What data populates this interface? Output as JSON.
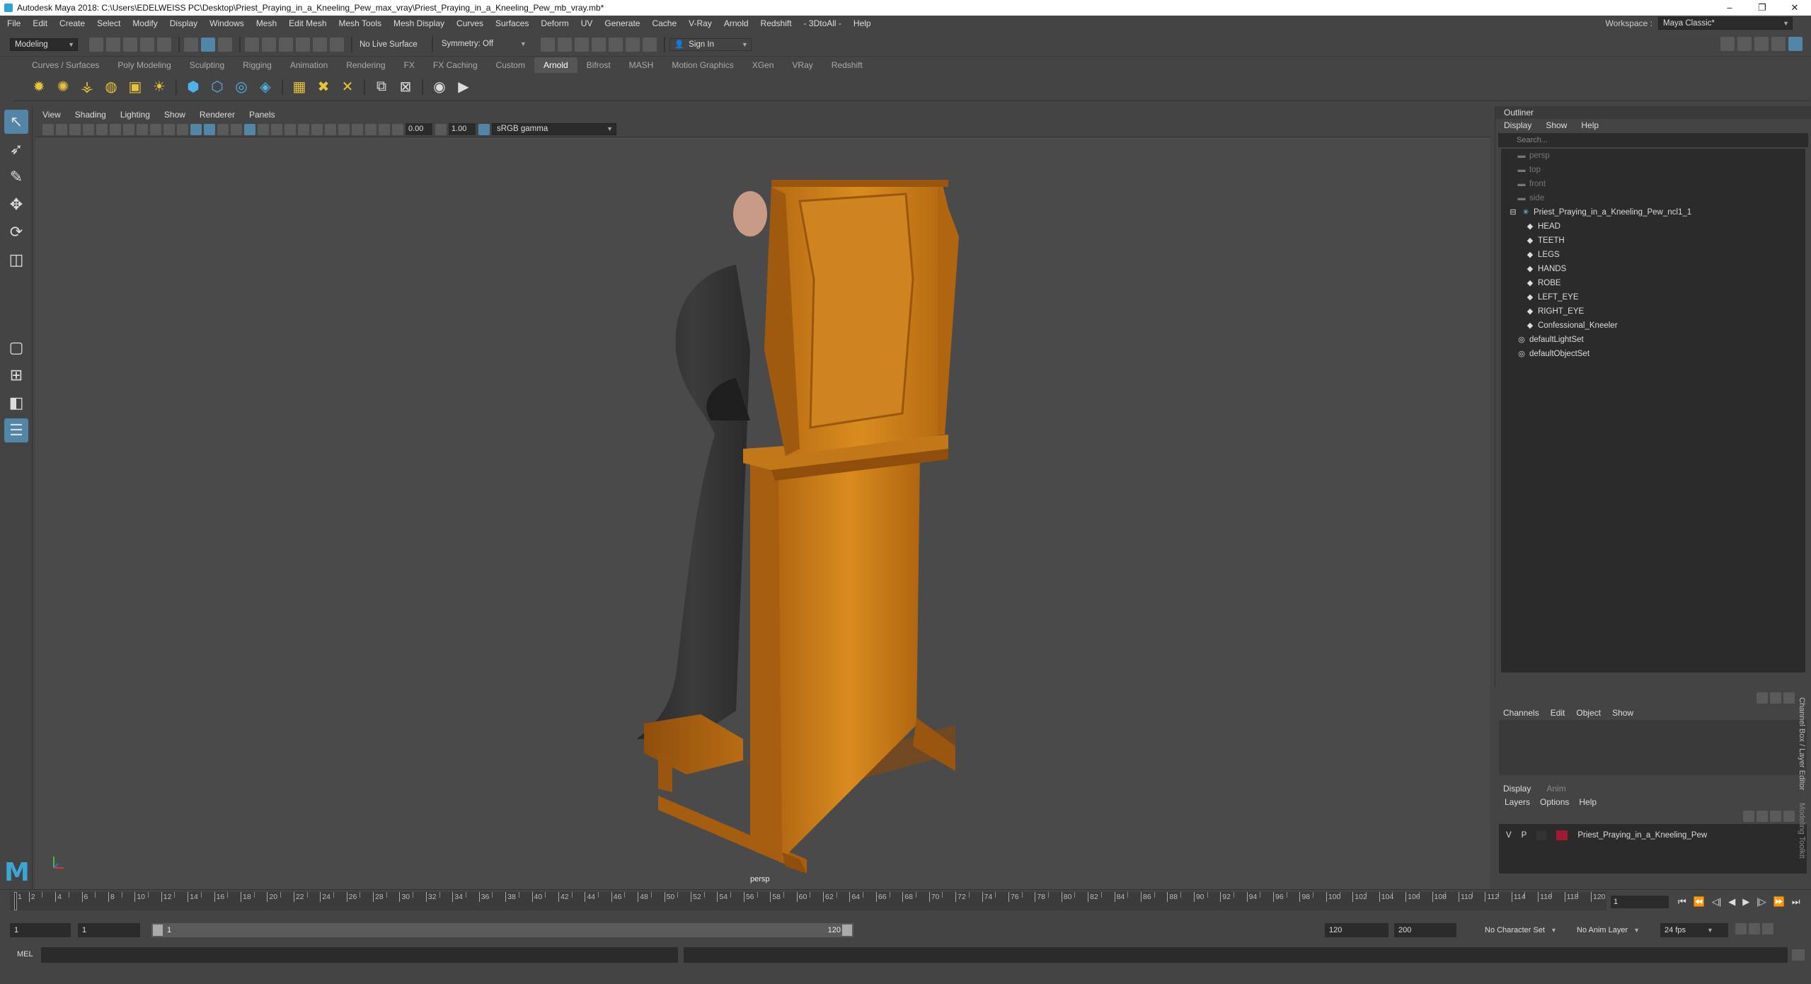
{
  "app": {
    "title": "Autodesk Maya 2018: C:\\Users\\EDELWEISS PC\\Desktop\\Priest_Praying_in_a_Kneeling_Pew_max_vray\\Priest_Praying_in_a_Kneeling_Pew_mb_vray.mb*"
  },
  "window_buttons": [
    "–",
    "❐",
    "✕"
  ],
  "menubar": [
    "File",
    "Edit",
    "Create",
    "Select",
    "Modify",
    "Display",
    "Windows",
    "Mesh",
    "Edit Mesh",
    "Mesh Tools",
    "Mesh Display",
    "Curves",
    "Surfaces",
    "Deform",
    "UV",
    "Generate",
    "Cache",
    "V-Ray",
    "Arnold",
    "Redshift",
    "- 3DtoAll -",
    "Help"
  ],
  "workspace": {
    "label": "Workspace :",
    "value": "Maya Classic*"
  },
  "status": {
    "mode": "Modeling",
    "live_surface": "No Live Surface",
    "symmetry": "Symmetry: Off",
    "sign_in": "Sign In"
  },
  "shelf_tabs": [
    "Curves / Surfaces",
    "Poly Modeling",
    "Sculpting",
    "Rigging",
    "Animation",
    "Rendering",
    "FX",
    "FX Caching",
    "Custom",
    "Arnold",
    "Bifrost",
    "MASH",
    "Motion Graphics",
    "XGen",
    "VRay",
    "Redshift"
  ],
  "shelf_active": "Arnold",
  "viewport": {
    "menu": [
      "View",
      "Shading",
      "Lighting",
      "Show",
      "Renderer",
      "Panels"
    ],
    "exposure": "0.00",
    "gamma": "1.00",
    "colorspace": "sRGB gamma",
    "camera": "persp"
  },
  "outliner": {
    "title": "Outliner",
    "menu": [
      "Display",
      "Show",
      "Help"
    ],
    "search_placeholder": "Search...",
    "items": [
      {
        "label": "persp",
        "icon": "camera-icon",
        "dim": true,
        "indent": 1
      },
      {
        "label": "top",
        "icon": "camera-icon",
        "dim": true,
        "indent": 1
      },
      {
        "label": "front",
        "icon": "camera-icon",
        "dim": true,
        "indent": 1
      },
      {
        "label": "side",
        "icon": "camera-icon",
        "dim": true,
        "indent": 1
      },
      {
        "label": "Priest_Praying_in_a_Kneeling_Pew_ncl1_1",
        "icon": "group-icon",
        "dim": false,
        "indent": 0
      },
      {
        "label": "HEAD",
        "icon": "mesh-icon",
        "dim": false,
        "indent": 2
      },
      {
        "label": "TEETH",
        "icon": "mesh-icon",
        "dim": false,
        "indent": 2
      },
      {
        "label": "LEGS",
        "icon": "mesh-icon",
        "dim": false,
        "indent": 2
      },
      {
        "label": "HANDS",
        "icon": "mesh-icon",
        "dim": false,
        "indent": 2
      },
      {
        "label": "ROBE",
        "icon": "mesh-icon",
        "dim": false,
        "indent": 2
      },
      {
        "label": "LEFT_EYE",
        "icon": "mesh-icon",
        "dim": false,
        "indent": 2
      },
      {
        "label": "RIGHT_EYE",
        "icon": "mesh-icon",
        "dim": false,
        "indent": 2
      },
      {
        "label": "Confessional_Kneeler",
        "icon": "mesh-icon",
        "dim": false,
        "indent": 2
      },
      {
        "label": "defaultLightSet",
        "icon": "set-icon",
        "dim": false,
        "indent": 1
      },
      {
        "label": "defaultObjectSet",
        "icon": "set-icon",
        "dim": false,
        "indent": 1
      }
    ]
  },
  "channels": {
    "menu": [
      "Channels",
      "Edit",
      "Object",
      "Show"
    ]
  },
  "layers": {
    "tabs": [
      "Display",
      "Anim"
    ],
    "menu": [
      "Layers",
      "Options",
      "Help"
    ],
    "rows": [
      {
        "v": "V",
        "p": "P",
        "name": "Priest_Praying_in_a_Kneeling_Pew",
        "color": "#a11a31"
      }
    ]
  },
  "side_tabs": [
    "Channel Box / Layer Editor",
    "Modeling Toolkit"
  ],
  "timeline": {
    "ticks": [
      1,
      2,
      4,
      6,
      8,
      10,
      12,
      14,
      16,
      18,
      20,
      22,
      24,
      26,
      28,
      30,
      32,
      34,
      36,
      38,
      40,
      42,
      44,
      46,
      48,
      50,
      52,
      54,
      56,
      58,
      60,
      62,
      64,
      66,
      68,
      70,
      72,
      74,
      76,
      78,
      80,
      82,
      84,
      86,
      88,
      90,
      92,
      94,
      96,
      98,
      100,
      102,
      104,
      106,
      108,
      110,
      112,
      114,
      116,
      118,
      120
    ],
    "min": 1,
    "max": 120,
    "current_frame": "1"
  },
  "range": {
    "start": "1",
    "inner_start": "1",
    "slider_start": "1",
    "slider_end": "120",
    "end": "120",
    "max": "200",
    "character_set": "No Character Set",
    "anim_layer": "No Anim Layer",
    "fps": "24 fps"
  },
  "cmd": {
    "label": "MEL"
  }
}
